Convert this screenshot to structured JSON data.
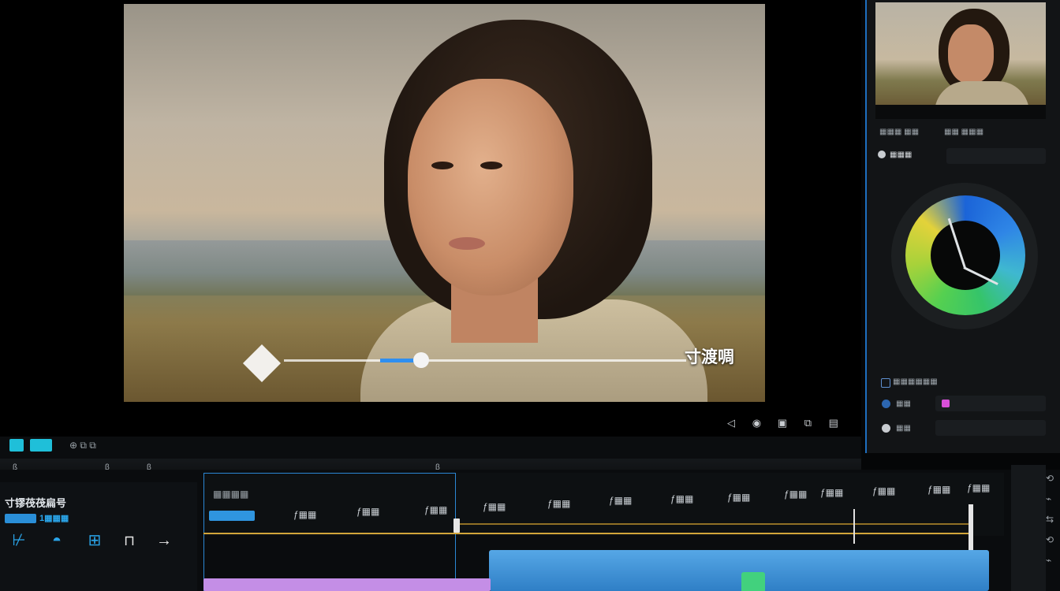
{
  "viewer": {
    "overlay_text": "寸渡啁",
    "slider_value_pct": 42
  },
  "viewer_controls": {
    "icons": [
      "rewind-icon",
      "loop-icon",
      "grid-icon",
      "export-icon",
      "settings-icon"
    ]
  },
  "mini_toolbar": {
    "label": "⊕ ⧉ ⧉",
    "ruler_ticks": [
      "ß",
      "β",
      "β",
      "β"
    ]
  },
  "colors": {
    "accent_blue": "#2f8ff0",
    "panel_border": "#1e6fbf",
    "timeline_gold": "#d2a63a",
    "clip_blue": "#3a8ed6",
    "clip_pink": "#c48ee6",
    "clip_green": "#42d17d"
  },
  "right_panel": {
    "tab_left": "▦▦▦ ▦▦",
    "tab_right": "▦▦ ▦▦▦",
    "section_label": "▦▦▦",
    "prop_1": "▦▦▦▦▦▦",
    "prop_2": "▦▦",
    "prop_3": "▦▦"
  },
  "timeline": {
    "track_title": "寸镠茷茷扁号",
    "sub_label": "1▦▦▦",
    "clip_label": "▦▦▦▦",
    "tick_labels": [
      "ƒ▦▦",
      "ƒ▦▦",
      "ƒ▦▦",
      "ƒ▦▦",
      "ƒ▦▦",
      "ƒ▦▦",
      "ƒ▦▦",
      "ƒ▦▦",
      "ƒ▦▦",
      "ƒ▦▦",
      "ƒ▦▦",
      "ƒ▦▦",
      "ƒ▦▦",
      "ƒ▦▦"
    ],
    "tools": [
      "split-icon",
      "mask-icon",
      "crop-icon",
      "lock-icon",
      "arrow-icon"
    ]
  }
}
